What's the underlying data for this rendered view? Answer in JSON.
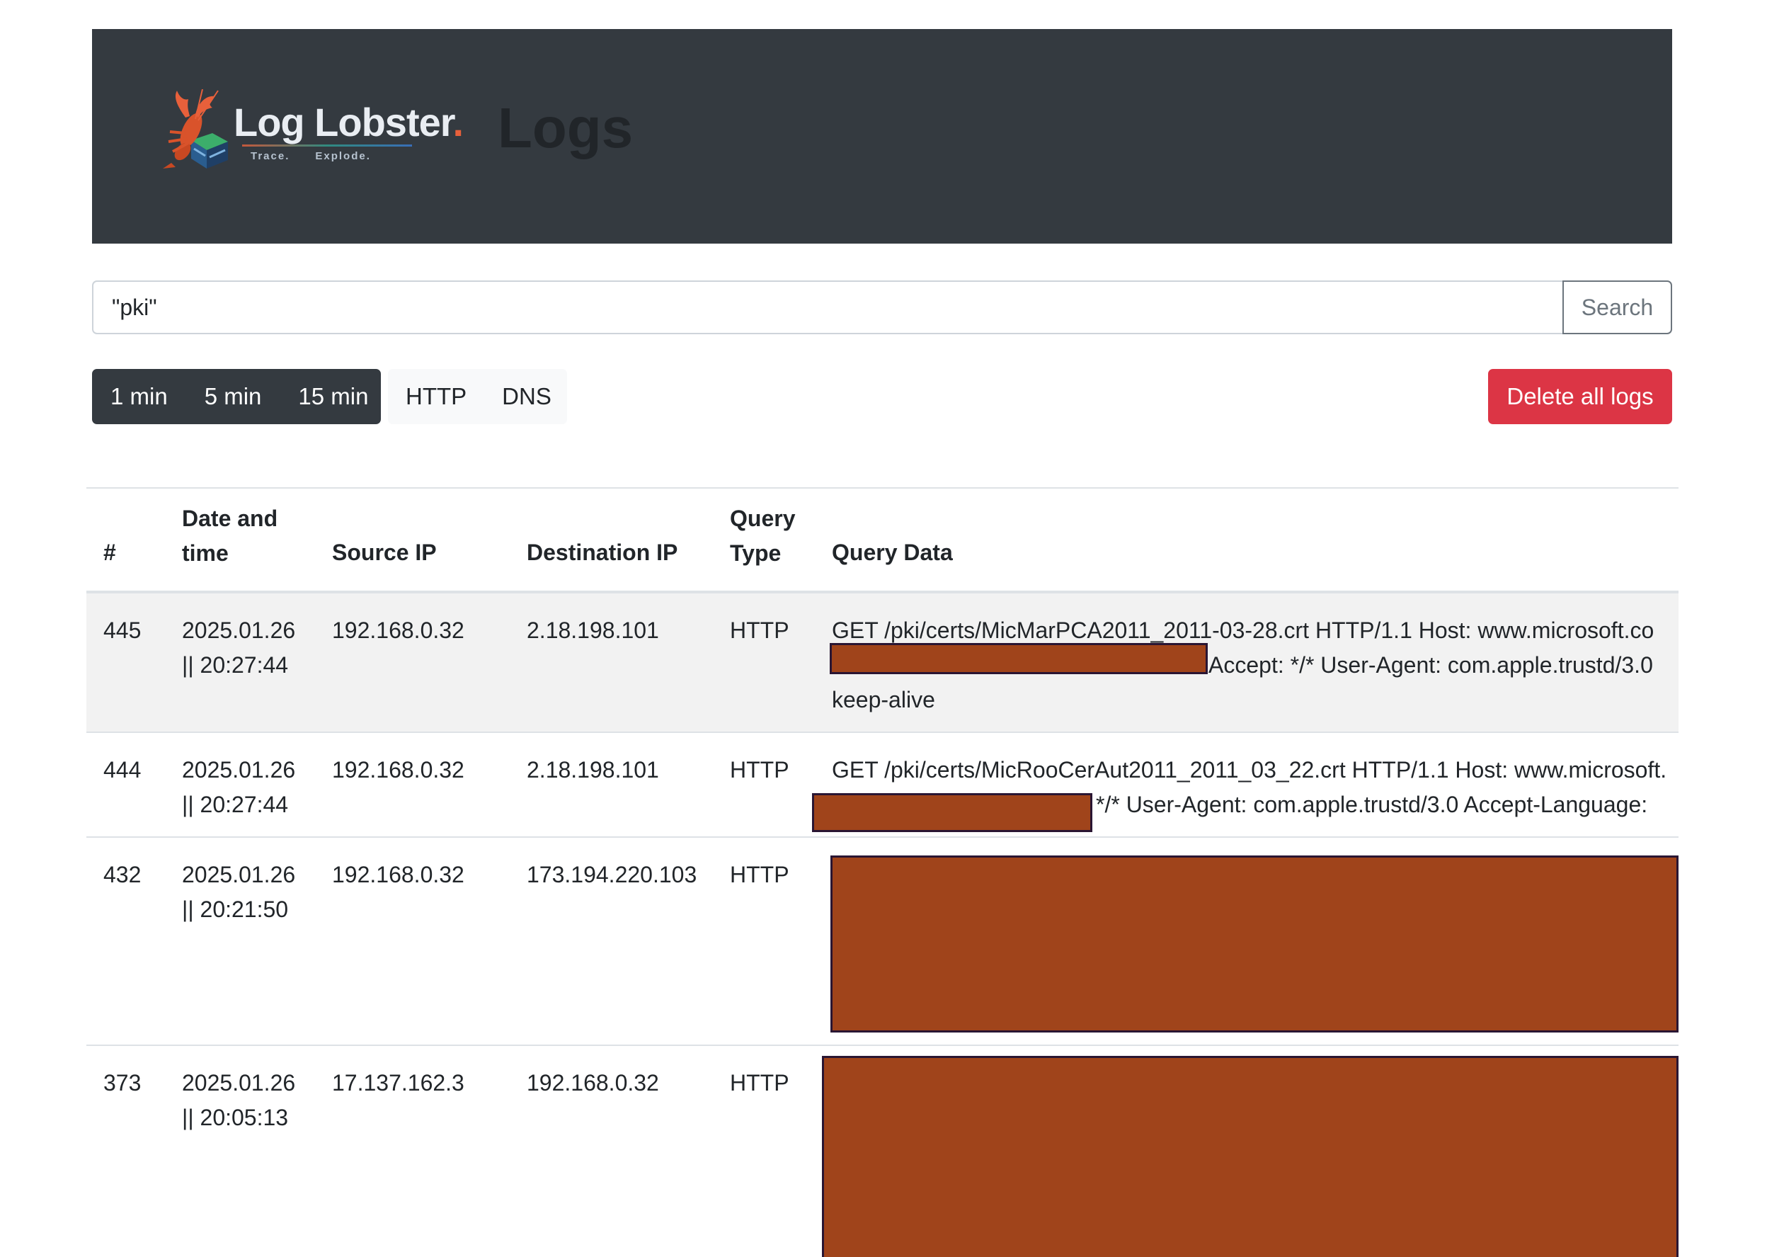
{
  "header": {
    "logo_name": "Log Lobster",
    "logo_dot": ".",
    "logo_tagline": [
      "Trace.",
      "Explode."
    ],
    "page_title": "Logs"
  },
  "search": {
    "value": "\"pki\"",
    "button_label": "Search"
  },
  "filters": {
    "time_ranges": [
      "1 min",
      "5 min",
      "15 min"
    ],
    "types": [
      "HTTP",
      "DNS"
    ],
    "delete_label": "Delete all logs"
  },
  "table": {
    "headers": {
      "num": "#",
      "date_line1": "Date and",
      "date_line2": "time",
      "source": "Source IP",
      "destination": "Destination IP",
      "type_line1": "Query",
      "type_line2": "Type",
      "data": "Query Data"
    },
    "rows": [
      {
        "num": "445",
        "date": "2025.01.26",
        "time": "|| 20:27:44",
        "source": "192.168.0.32",
        "destination": "2.18.198.101",
        "type": "HTTP",
        "data_line1": "GET /pki/certs/MicMarPCA2011_2011-03-28.crt HTTP/1.1 Host: www.microsoft.co",
        "data_line2": "Accept: */* User-Agent: com.apple.trustd/3.0",
        "data_line3": "keep-alive"
      },
      {
        "num": "444",
        "date": "2025.01.26",
        "time": "|| 20:27:44",
        "source": "192.168.0.32",
        "destination": "2.18.198.101",
        "type": "HTTP",
        "data_line1": "GET /pki/certs/MicRooCerAut2011_2011_03_22.crt HTTP/1.1 Host: www.microsoft.",
        "data_line2": "*/* User-Agent: com.apple.trustd/3.0 Accept-Language:"
      },
      {
        "num": "432",
        "date": "2025.01.26",
        "time": "|| 20:21:50",
        "source": "192.168.0.32",
        "destination": "173.194.220.103",
        "type": "HTTP"
      },
      {
        "num": "373",
        "date": "2025.01.26",
        "time": "|| 20:05:13",
        "source": "17.137.162.3",
        "destination": "192.168.0.32",
        "type": "HTTP"
      }
    ]
  },
  "colors": {
    "header_bg": "#343a40",
    "danger": "#dc3545",
    "redaction": "#a0441b",
    "logo_accent": "#e8603b"
  }
}
